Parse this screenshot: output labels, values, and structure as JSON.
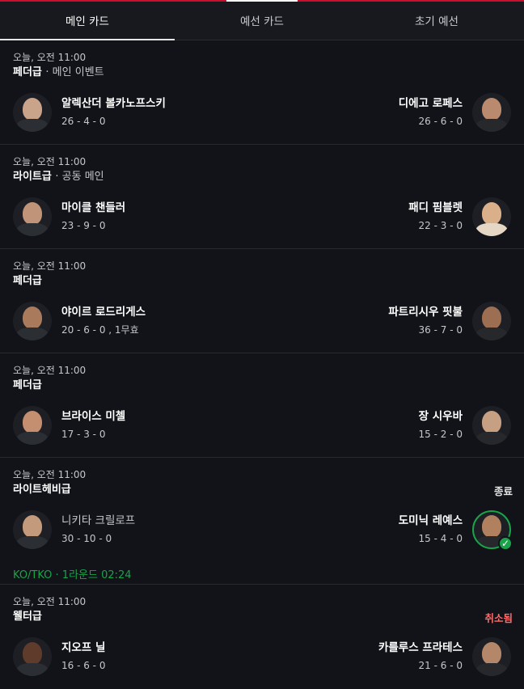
{
  "tabs": [
    {
      "label": "메인 카드",
      "active": true
    },
    {
      "label": "예선 카드",
      "active": false
    },
    {
      "label": "초기 예선",
      "active": false
    }
  ],
  "fights": [
    {
      "time": "오늘, 오전 11:00",
      "weight": "페더급",
      "weight_sub": "· 메인 이벤트",
      "status": "",
      "left": {
        "name": "알렉산더 볼카노프스키",
        "record": "26 - 4 - 0"
      },
      "right": {
        "name": "디에고 로페스",
        "record": "26 - 6 - 0"
      },
      "result": ""
    },
    {
      "time": "오늘, 오전 11:00",
      "weight": "라이트급",
      "weight_sub": "· 공동 메인",
      "status": "",
      "left": {
        "name": "마이클 챈들러",
        "record": "23 - 9 - 0"
      },
      "right": {
        "name": "패디 핌블렛",
        "record": "22 - 3 - 0"
      },
      "result": ""
    },
    {
      "time": "오늘, 오전 11:00",
      "weight": "페더급",
      "weight_sub": "",
      "status": "",
      "left": {
        "name": "야이르 로드리게스",
        "record": "20 - 6 - 0 , 1무효"
      },
      "right": {
        "name": "파트리시우 핏불",
        "record": "36 - 7 - 0"
      },
      "result": ""
    },
    {
      "time": "오늘, 오전 11:00",
      "weight": "페더급",
      "weight_sub": "",
      "status": "",
      "left": {
        "name": "브라이스 미첼",
        "record": "17 - 3 - 0"
      },
      "right": {
        "name": "장 시우바",
        "record": "15 - 2 - 0"
      },
      "result": ""
    },
    {
      "time": "오늘, 오전 11:00",
      "weight": "라이트헤비급",
      "weight_sub": "",
      "status": "종료",
      "left": {
        "name": "니키타 크릴로프",
        "record": "30 - 10 - 0"
      },
      "right": {
        "name": "도미닉 레예스",
        "record": "15 - 4 - 0"
      },
      "result": "KO/TKO · 1라운드 02:24"
    },
    {
      "time": "오늘, 오전 11:00",
      "weight": "웰터급",
      "weight_sub": "",
      "status": "취소됨",
      "left": {
        "name": "지오프 닐",
        "record": "16 - 6 - 0"
      },
      "right": {
        "name": "카를루스 프라테스",
        "record": "21 - 6 - 0"
      },
      "result": ""
    }
  ],
  "colors": {
    "accent": "#c8102e",
    "winner": "#1aa34a",
    "cancelled": "#ff6b6b"
  }
}
